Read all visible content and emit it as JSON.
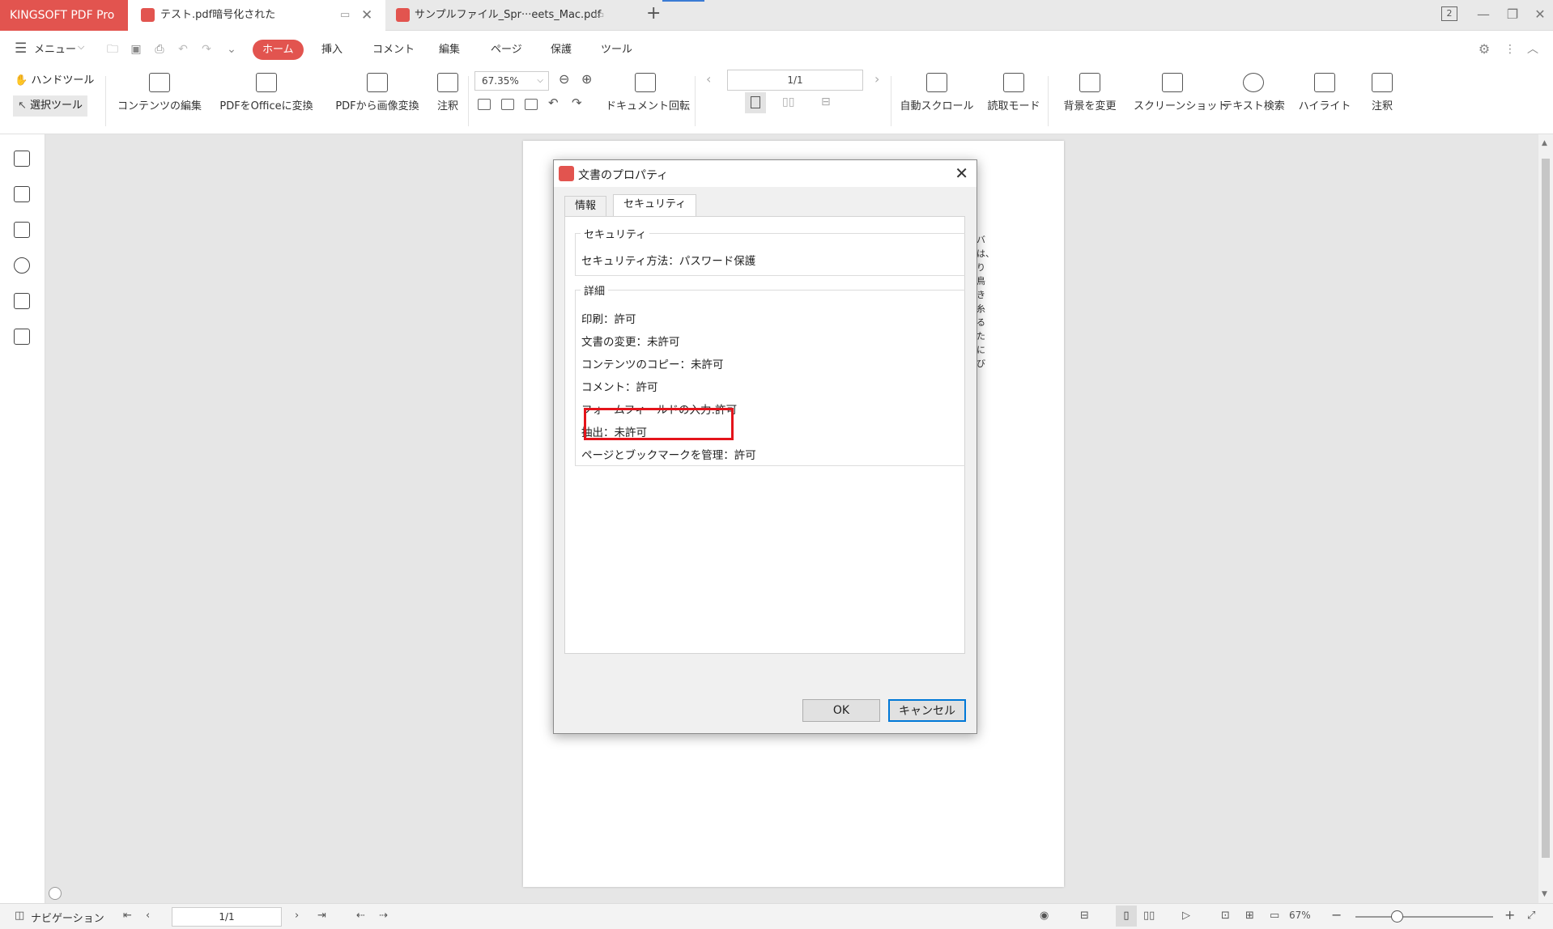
{
  "app": {
    "brand": "KINGSOFT PDF Pro"
  },
  "tabs": [
    {
      "label": "テスト.pdf暗号化された"
    },
    {
      "label": "サンプルファイル_Spr···eets_Mac.pdf"
    }
  ],
  "window_badge": "2",
  "menu": {
    "label": "メニュー"
  },
  "ribbon_tabs": [
    "ホーム",
    "挿入",
    "コメント",
    "編集",
    "ページ",
    "保護",
    "ツール"
  ],
  "tools": {
    "hand": "ハンドツール",
    "select": "選択ツール"
  },
  "toolbar": {
    "edit_content": "コンテンツの編集",
    "pdf_to_office": "PDFをOfficeに変換",
    "pdf_to_image": "PDFから画像変換",
    "annotate": "注釈",
    "zoom": "67.35%",
    "rotate_doc": "ドキュメント回転",
    "page_input": "1/1",
    "auto_scroll": "自動スクロール",
    "read_mode": "読取モード",
    "bg_change": "背景を変更",
    "screenshot": "スクリーンショット",
    "text_search": "テキスト検索",
    "highlight": "ハイライト",
    "annotate2": "注釈"
  },
  "page_vertical_text": "バは、り鳥き糸るたにび",
  "dialog": {
    "title": "文書のプロパティ",
    "tabs": [
      "情報",
      "セキュリティ"
    ],
    "security_group": "セキュリティ",
    "security_method": "セキュリティ方法：パスワード保護",
    "detail_group": "詳細",
    "details": [
      "印刷：許可",
      "文書の変更：未許可",
      "コンテンツのコピー：未許可",
      "コメント：許可",
      "フォームフィールドの入力:許可",
      "抽出：未許可",
      "ページとブックマークを管理：許可"
    ],
    "ok": "OK",
    "cancel": "キャンセル"
  },
  "status": {
    "navigation": "ナビゲーション",
    "page": "1/1",
    "zoom": "67%"
  },
  "colors": {
    "accent": "#e2544f",
    "highlight_box": "#e4141b"
  }
}
